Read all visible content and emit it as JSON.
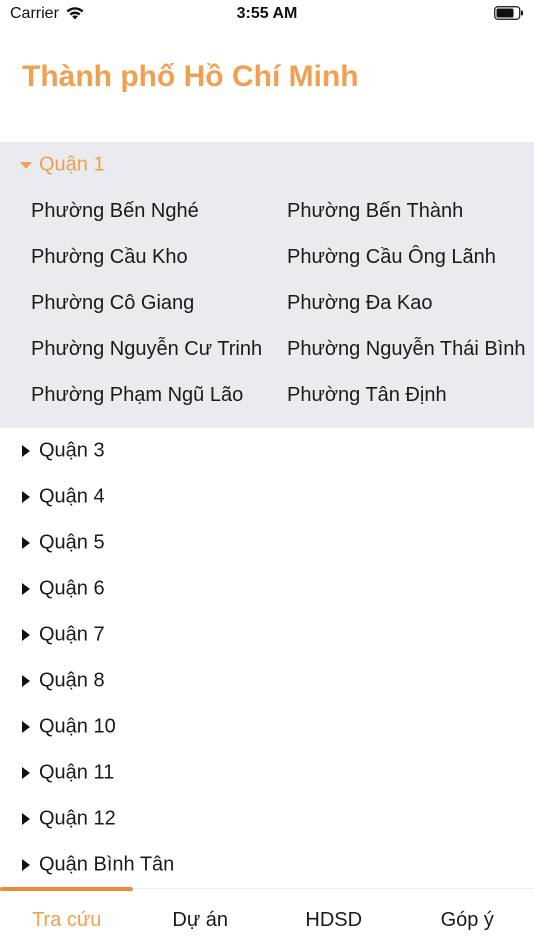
{
  "status_bar": {
    "carrier": "Carrier",
    "time": "3:55 AM"
  },
  "page": {
    "title": "Thành phố Hồ Chí Minh"
  },
  "colors": {
    "accent": "#f0a050",
    "expanded_bg": "#e9ebee"
  },
  "expanded_group": {
    "label": "Quận 1",
    "wards": [
      "Phường Bến Nghé",
      "Phường Bến Thành",
      "Phường Cầu Kho",
      "Phường Cầu Ông Lãnh",
      "Phường Cô Giang",
      "Phường Đa Kao",
      "Phường Nguyễn Cư Trinh",
      "Phường Nguyễn Thái Bình",
      "Phường Phạm Ngũ Lão",
      "Phường Tân Định"
    ]
  },
  "collapsed_groups": [
    "Quận 3",
    "Quận 4",
    "Quận 5",
    "Quận 6",
    "Quận 7",
    "Quận 8",
    "Quận 10",
    "Quận 11",
    "Quận 12",
    "Quận Bình Tân"
  ],
  "tabs": [
    {
      "label": "Tra cứu",
      "active": true
    },
    {
      "label": "Dự án",
      "active": false
    },
    {
      "label": "HDSD",
      "active": false
    },
    {
      "label": "Góp ý",
      "active": false
    }
  ]
}
